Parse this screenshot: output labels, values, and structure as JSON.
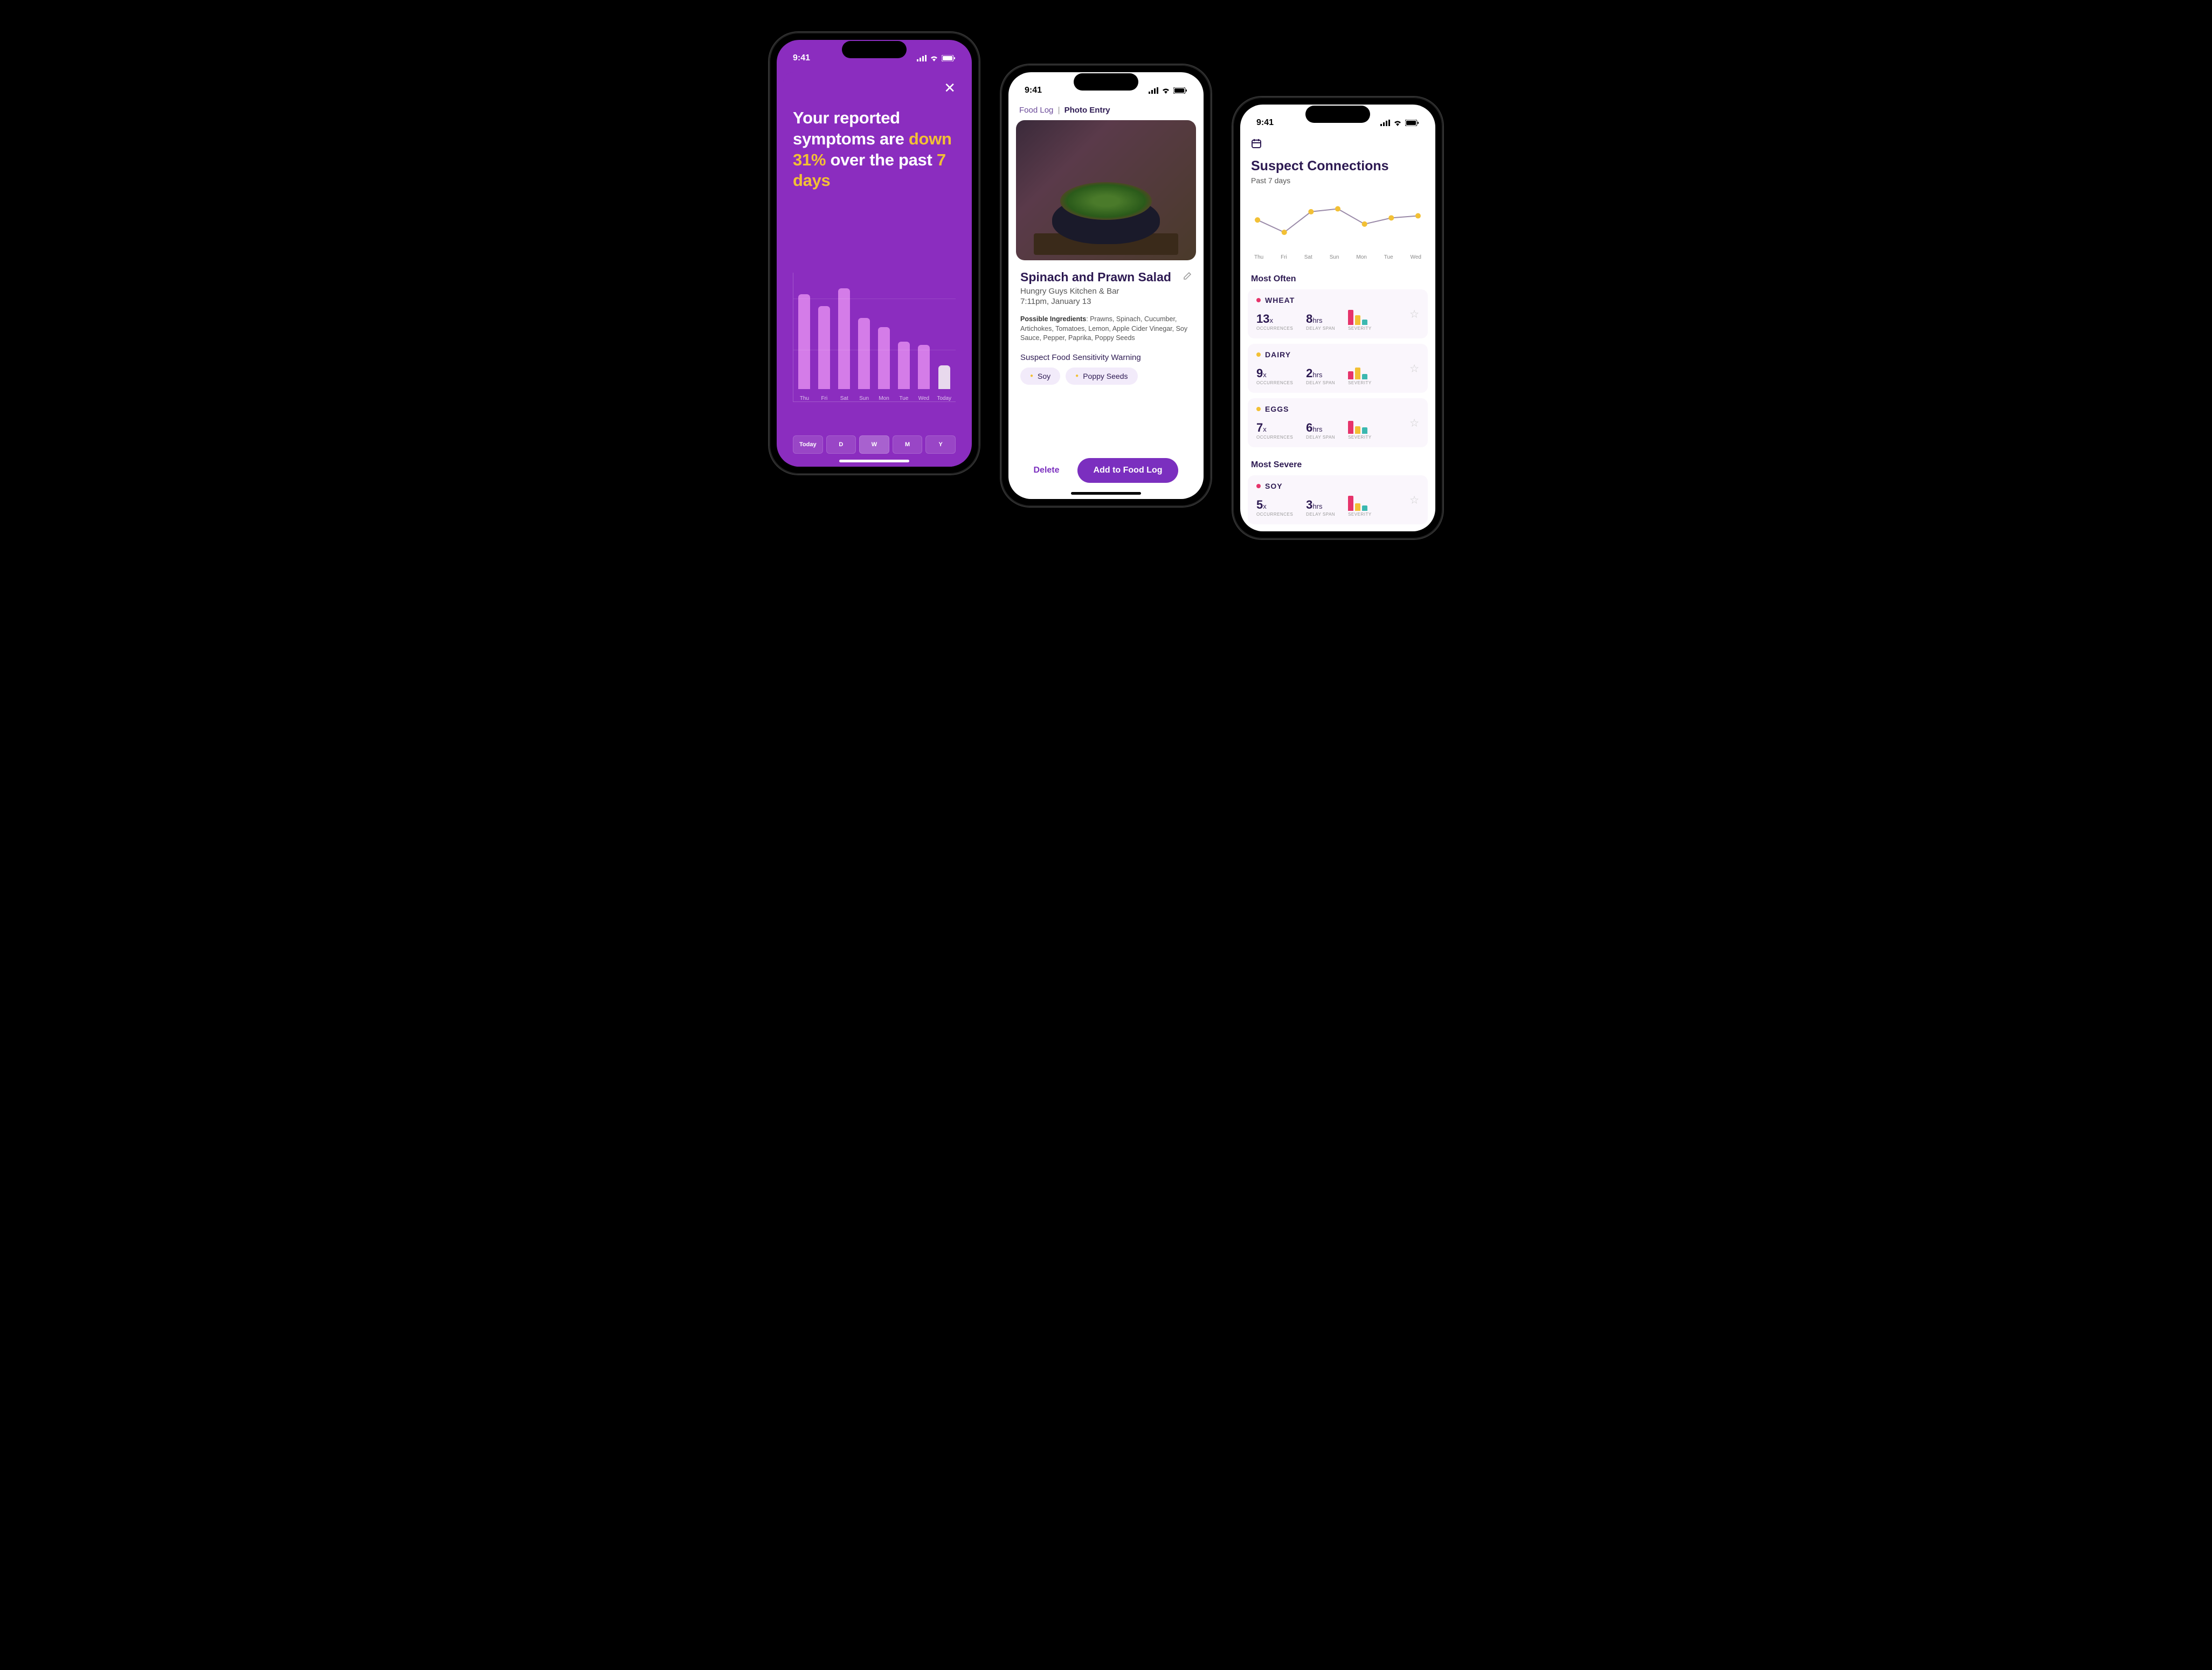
{
  "status_time": "9:41",
  "phone1": {
    "headline_p1": "Your reported symptoms are ",
    "headline_accent1": "down 31%",
    "headline_p2": " over the past ",
    "headline_accent2": "7 days",
    "tabs": [
      "Today",
      "D",
      "W",
      "M",
      "Y"
    ],
    "active_tab": "W",
    "chart_data": {
      "type": "bar",
      "categories": [
        "Thu",
        "Fri",
        "Sat",
        "Sun",
        "Mon",
        "Tue",
        "Wed",
        "Today"
      ],
      "values": [
        160,
        140,
        170,
        120,
        105,
        80,
        75,
        40
      ],
      "ylim": [
        0,
        200
      ]
    }
  },
  "phone2": {
    "crumb_parent": "Food Log",
    "crumb_sep": "|",
    "crumb_current": "Photo Entry",
    "title": "Spinach and Prawn Salad",
    "place": "Hungry Guys Kitchen & Bar",
    "time": "7:11pm, January 13",
    "ing_label": "Possible Ingredients",
    "ing_list": ": Prawns, Spinach, Cucumber, Artichokes, Tomatoes, Lemon, Apple Cider Vinegar, Soy Sauce, Pepper, Paprika, Poppy Seeds",
    "warning": "Suspect Food Sensitivity Warning",
    "chips": [
      "Soy",
      "Poppy Seeds"
    ],
    "delete": "Delete",
    "add": "Add to Food Log"
  },
  "phone3": {
    "title": "Suspect Connections",
    "subtitle": "Past 7 days",
    "chart_data": {
      "type": "line",
      "categories": [
        "Thu",
        "Fri",
        "Sat",
        "Sun",
        "Mon",
        "Tue",
        "Wed"
      ],
      "values": [
        55,
        25,
        75,
        82,
        45,
        60,
        65
      ],
      "ylim": [
        0,
        100
      ]
    },
    "most_often_h": "Most Often",
    "most_severe_h": "Most Severe",
    "labels": {
      "occ": "OCCURRENCES",
      "delay": "DELAY SPAN",
      "sev": "SEVERITY",
      "x": "x",
      "hrs": "hrs"
    },
    "cards_often": [
      {
        "name": "WHEAT",
        "dot": "#e6336b",
        "occ": "13",
        "delay": "8",
        "sev": [
          28,
          18,
          10
        ],
        "colors": [
          "#e6336b",
          "#f2c035",
          "#3bb8b0"
        ]
      },
      {
        "name": "DAIRY",
        "dot": "#f2c035",
        "occ": "9",
        "delay": "2",
        "sev": [
          15,
          22,
          10
        ],
        "colors": [
          "#e6336b",
          "#f2c035",
          "#3bb8b0"
        ]
      },
      {
        "name": "EGGS",
        "dot": "#f2c035",
        "occ": "7",
        "delay": "6",
        "sev": [
          24,
          14,
          12
        ],
        "colors": [
          "#e6336b",
          "#f2c035",
          "#3bb8b0"
        ]
      }
    ],
    "cards_severe": [
      {
        "name": "SOY",
        "dot": "#e6336b",
        "occ": "5",
        "delay": "3",
        "sev": [
          28,
          14,
          10
        ],
        "colors": [
          "#e6336b",
          "#f2c035",
          "#3bb8b0"
        ]
      }
    ]
  }
}
